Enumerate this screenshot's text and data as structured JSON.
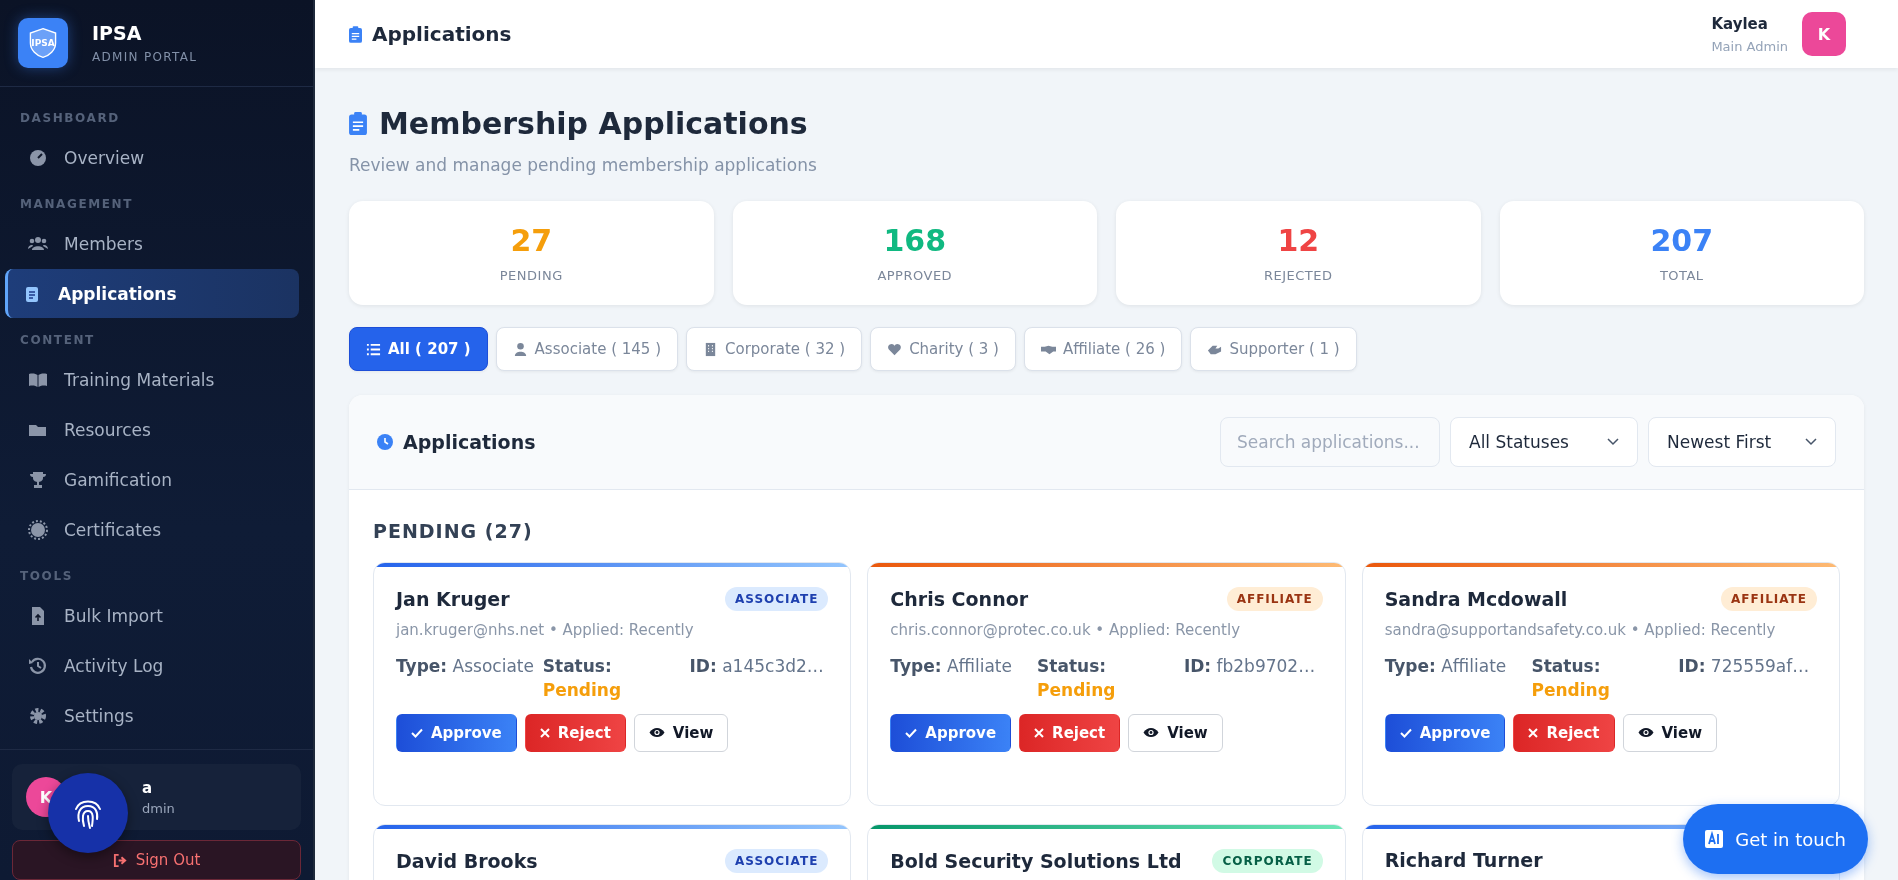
{
  "sidebar": {
    "brand": {
      "logo_text": "IPSA",
      "title": "IPSA",
      "subtitle": "ADMIN PORTAL"
    },
    "sections": [
      {
        "title": "DASHBOARD",
        "items": [
          {
            "label": "Overview",
            "selected": false
          }
        ]
      },
      {
        "title": "MANAGEMENT",
        "items": [
          {
            "label": "Members",
            "selected": false
          },
          {
            "label": "Applications",
            "selected": true
          }
        ]
      },
      {
        "title": "CONTENT",
        "items": [
          {
            "label": "Training Materials",
            "selected": false
          },
          {
            "label": "Resources",
            "selected": false
          },
          {
            "label": "Gamification",
            "selected": false
          },
          {
            "label": "Certificates",
            "selected": false
          }
        ]
      },
      {
        "title": "TOOLS",
        "items": [
          {
            "label": "Bulk Import",
            "selected": false
          },
          {
            "label": "Activity Log",
            "selected": false
          },
          {
            "label": "Settings",
            "selected": false
          }
        ]
      }
    ],
    "user": {
      "avatar": "K",
      "name": "a",
      "role": "dmin"
    },
    "sign_out": "Sign Out"
  },
  "header": {
    "title": "Applications",
    "user_name": "Kaylea",
    "user_role": "Main Admin",
    "avatar": "K"
  },
  "page": {
    "title": "Membership Applications",
    "subtitle": "Review and manage pending membership applications"
  },
  "stats": [
    {
      "value": "27",
      "label": "PENDING",
      "color": "#f59e0b"
    },
    {
      "value": "168",
      "label": "APPROVED",
      "color": "#10b981"
    },
    {
      "value": "12",
      "label": "REJECTED",
      "color": "#ef4444"
    },
    {
      "value": "207",
      "label": "TOTAL",
      "color": "#3b82f6"
    }
  ],
  "filters": [
    {
      "label": "All ( 207 )",
      "selected": true
    },
    {
      "label": "Associate ( 145 )",
      "selected": false
    },
    {
      "label": "Corporate ( 32 )",
      "selected": false
    },
    {
      "label": "Charity ( 3 )",
      "selected": false
    },
    {
      "label": "Affiliate ( 26 )",
      "selected": false
    },
    {
      "label": "Supporter ( 1 )",
      "selected": false
    }
  ],
  "panel": {
    "title": "Applications",
    "search": {
      "placeholder": "Search applications..."
    },
    "status_select": "All Statuses",
    "sort_select": "Newest First",
    "group_title": "PENDING (27)"
  },
  "cards": [
    {
      "kind": "associate",
      "name": "Jan Kruger",
      "badge": "ASSOCIATE",
      "meta": "jan.kruger@nhs.net • Applied: Recently",
      "type": "**Type:** Associate",
      "status_label": "Status:",
      "status": "Pending",
      "id": "**ID:** a145c3d2…",
      "approve": "Approve",
      "reject": "Reject",
      "view": "View"
    },
    {
      "kind": "affiliate",
      "name": "Chris Connor",
      "badge": "AFFILIATE",
      "meta": "chris.connor@protec.co.uk • Applied: Recently",
      "type": "**Type:** Affiliate",
      "status_label": "Status:",
      "status": "Pending",
      "id": "**ID:** fb2b9702…",
      "approve": "Approve",
      "reject": "Reject",
      "view": "View"
    },
    {
      "kind": "affiliate",
      "name": "Sandra Mcdowall",
      "badge": "AFFILIATE",
      "meta": "sandra@supportandsafety.co.uk • Applied: Recently",
      "type": "**Type:** Affiliate",
      "status_label": "Status:",
      "status": "Pending",
      "id": "**ID:** 725559af…",
      "approve": "Approve",
      "reject": "Reject",
      "view": "View"
    },
    {
      "kind": "associate",
      "name": "David Brooks",
      "badge": "ASSOCIATE"
    },
    {
      "kind": "corporate",
      "name": "Bold Security Solutions Ltd",
      "badge": "CORPORATE"
    },
    {
      "kind": "associate",
      "name": "Richard Turner"
    }
  ],
  "contact_button": {
    "label": "Get in touch"
  }
}
